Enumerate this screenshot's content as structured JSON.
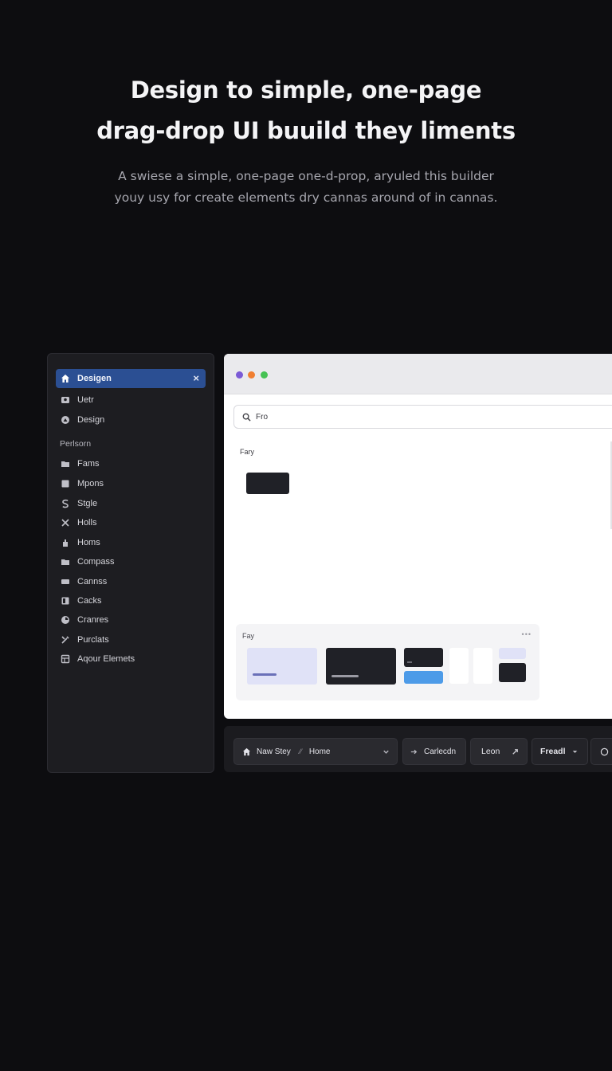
{
  "hero": {
    "title_line1": "Design to simple, one-page",
    "title_line2": "drag-drop UI buuild they liments",
    "subtitle_line1": "A swiese a simple, one-page one-d-prop, aryuled this builder",
    "subtitle_line2": "youy usy for create elements dry cannas around of in cannas."
  },
  "sidebar": {
    "active_item": {
      "label": "Desigen",
      "icon": "home-icon",
      "close": "×"
    },
    "items": [
      {
        "label": "Uetr",
        "icon": "user-icon"
      },
      {
        "label": "Design",
        "icon": "design-icon"
      }
    ],
    "section_label": "Perlsorn",
    "section_items": [
      {
        "label": "Fams",
        "icon": "folder-icon"
      },
      {
        "label": "Mpons",
        "icon": "square-icon"
      },
      {
        "label": "Stgle",
        "icon": "style-icon"
      },
      {
        "label": "Holls",
        "icon": "tools-icon"
      },
      {
        "label": "Homs",
        "icon": "hand-icon"
      },
      {
        "label": "Compass",
        "icon": "folder-icon"
      },
      {
        "label": "Cannss",
        "icon": "card-icon"
      },
      {
        "label": "Cacks",
        "icon": "calendar-icon"
      },
      {
        "label": "Cranres",
        "icon": "pie-icon"
      },
      {
        "label": "Purclats",
        "icon": "tools-icon"
      },
      {
        "label": "Aqour Elemets",
        "icon": "grid-icon"
      }
    ]
  },
  "window": {
    "dots": [
      "#7b5bd6",
      "#f07f32",
      "#46c254"
    ],
    "search": {
      "value": "Fro",
      "icon": "search-icon"
    },
    "canvas_label": "Fary",
    "library": {
      "label": "Fay",
      "more": "•••"
    }
  },
  "toolbar": {
    "page_select": {
      "icon": "home-icon",
      "label": "Naw Stey",
      "separator": "⁄⁄",
      "value": "Home",
      "chevron": "chevron-down-icon"
    },
    "connect": {
      "icon": "arrow-icon",
      "label": "Carlecdn"
    },
    "leon": {
      "label": "Leon",
      "icon": "expand-icon"
    },
    "freadl": {
      "label": "Freadl",
      "chevron": "chevron-down-icon"
    },
    "circle": {
      "icon": "circle-icon"
    }
  },
  "colors": {
    "accent": "#2b4f93",
    "background": "#0d0d10",
    "tile_blue": "#4d9be8",
    "tile_lavender": "#e0e2f7"
  }
}
